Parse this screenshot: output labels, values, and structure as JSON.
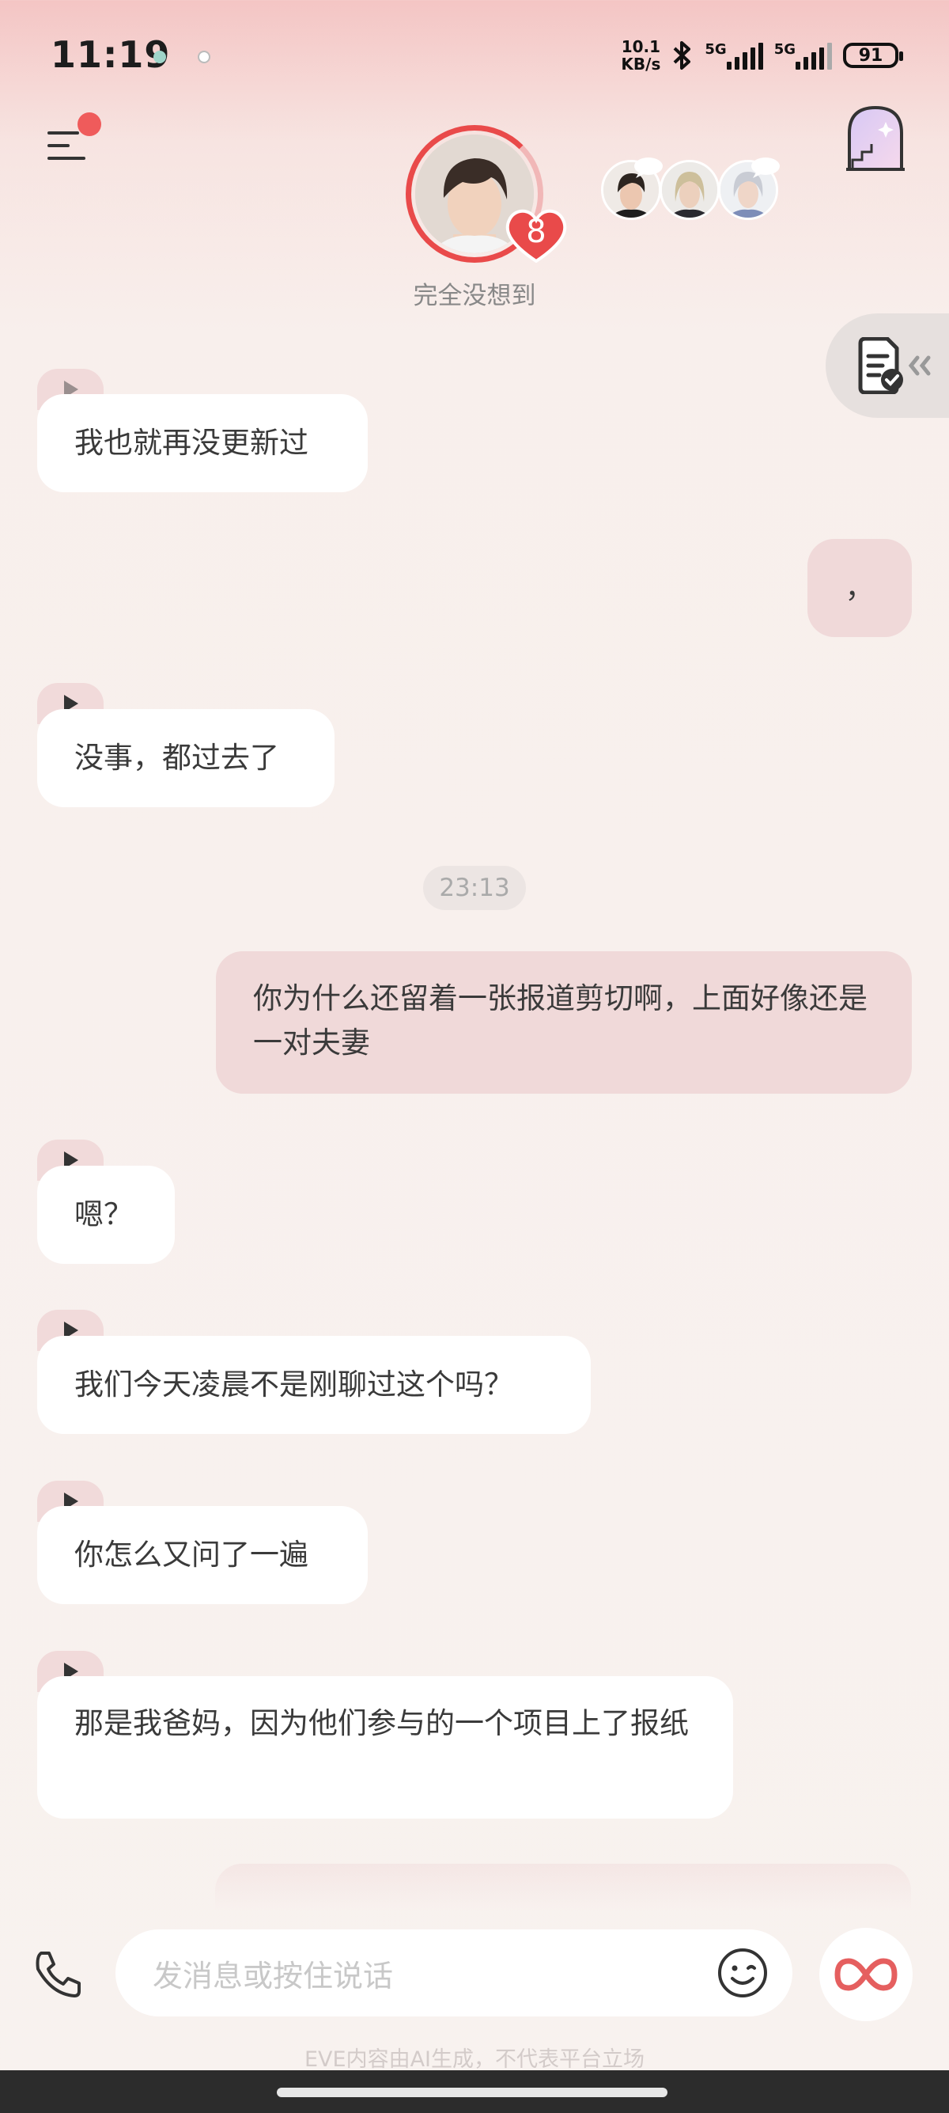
{
  "status_bar": {
    "time": "11:19",
    "net_speed_value": "10.1",
    "net_speed_unit": "KB/s",
    "signal1_label": "5G",
    "signal2_label": "5G",
    "battery": "91"
  },
  "header": {
    "character_name": "完全没想到",
    "affection_level": "8"
  },
  "messages": [
    {
      "from": "ai",
      "text": "我也就再没更新过"
    },
    {
      "from": "me",
      "text": "，"
    },
    {
      "from": "ai",
      "text": "没事，都过去了"
    },
    {
      "type": "time",
      "text": "23:13"
    },
    {
      "from": "me",
      "text": "你为什么还留着一张报道剪切啊，上面好像还是一对夫妻"
    },
    {
      "from": "ai",
      "text": "嗯？"
    },
    {
      "from": "ai",
      "text": "我们今天凌晨不是刚聊过这个吗？"
    },
    {
      "from": "ai",
      "text": "你怎么又问了一遍"
    },
    {
      "from": "ai",
      "text": "那是我爸妈，因为他们参与的一个项目上了报纸"
    }
  ],
  "input": {
    "placeholder": "发消息或按住说话"
  },
  "disclaimer": "EVE内容由AI生成，不代表平台立场",
  "colors": {
    "accent": "#e94a4a",
    "ai_bubble": "#ffffff",
    "user_bubble": "#f0d9d9"
  }
}
